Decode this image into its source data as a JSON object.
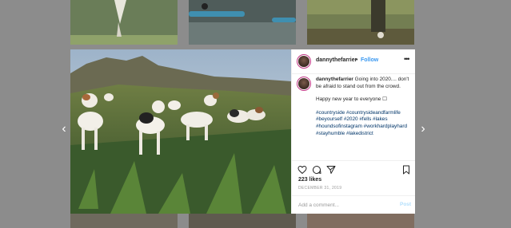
{
  "post": {
    "username": "dannythefarrier",
    "separator": "•",
    "follow_label": "Follow",
    "more_label": "•••",
    "caption_username": "dannythefarrier",
    "caption_text": "Going into 2020.... don't be afraid to stand out from the crowd.",
    "greeting": "Happy new year to everyone ☐",
    "hashtags": "#countryside #countrysideandfarmlife #beyourself #2020 #fells #lakes #houndsofinstagram #workhardplayhard #stayhumble #lakedistrict",
    "likes": "223 likes",
    "date": "DECEMBER 31, 2019",
    "comment_placeholder": "Add a comment...",
    "post_label": "Post"
  },
  "nav": {
    "prev": "‹",
    "next": "›"
  },
  "colors": {
    "accent": "#3897f0",
    "post_disabled": "#b2dffc",
    "overlay": "#8a8a8a"
  },
  "icons": [
    "heart-icon",
    "comment-icon",
    "share-icon",
    "bookmark-icon",
    "more-icon",
    "chevron-left-icon",
    "chevron-right-icon"
  ]
}
